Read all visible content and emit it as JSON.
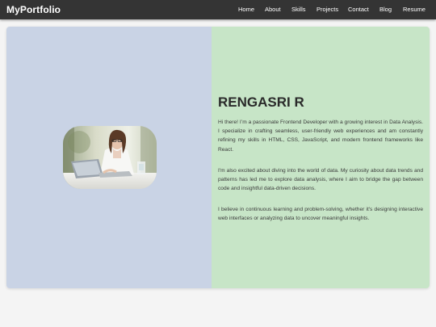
{
  "brand": "MyPortfolio",
  "nav": [
    "Home",
    "About",
    "Skills",
    "Projects",
    "Contact",
    "Blog",
    "Resume"
  ],
  "about": {
    "name": "RENGASRI R",
    "paragraphs": [
      "Hi there! I’m a passionate Frontend Developer with a growing interest in Data Analysis. I specialize in crafting seamless, user-friendly web experiences and am constantly refining my skills in HTML, CSS, JavaScript, and modern frontend frameworks like React.",
      "I'm also excited about diving into the world of data. My curiosity about data trends and patterns has led me to explore data analysis, where I aim to bridge the gap between code and insightful data-driven decisions.",
      "I believe in continuous learning and problem-solving, whether it's designing interactive web interfaces or analyzing data to uncover meaningful insights."
    ]
  },
  "colors": {
    "navbar": "#343434",
    "left_panel": "#c9d3e5",
    "right_panel": "#c7e5c7",
    "page_background": "#f4f4f4"
  }
}
